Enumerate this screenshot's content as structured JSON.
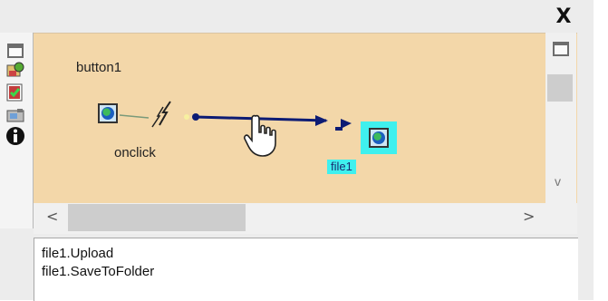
{
  "window": {
    "close_glyph": "X"
  },
  "canvas": {
    "source_component": "button1",
    "event_name": "onclick",
    "target_component": "file1",
    "background_color": "#f3d7a9",
    "link_color": "#0c1b74",
    "selection_color": "#3ff0ee"
  },
  "toolbar": {
    "icons": [
      "maximize-icon",
      "component-wizard-icon",
      "checklist-icon",
      "image-tool-icon",
      "properties-icon",
      "info-icon"
    ]
  },
  "scroll": {
    "left_arrow": "<",
    "right_arrow": ">",
    "down_arrow": "v"
  },
  "methods": {
    "items": [
      "file1.Upload",
      "file1.SaveToFolder"
    ]
  }
}
